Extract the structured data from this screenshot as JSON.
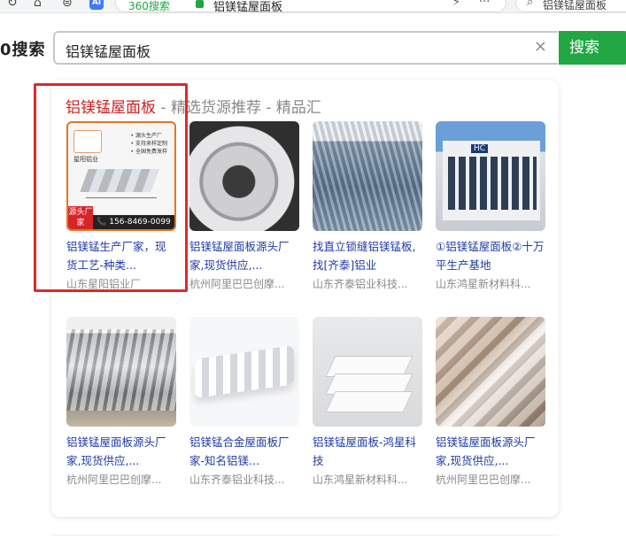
{
  "browser": {
    "tab_tag": "360搜索",
    "url_text": "铝镁锰屋面板",
    "side_search_text": "铝镁锰屋面板",
    "ai_badge": "AI"
  },
  "header": {
    "brand": "0搜索",
    "query": "铝镁锰屋面板",
    "clear_glyph": "×",
    "search_button": "搜索"
  },
  "result": {
    "title_highlight": "铝镁锰屋面板",
    "title_rest": " - 精选货源推荐 - 精品汇",
    "items": [
      {
        "title": "铝镁锰生产厂家，现货工艺-种类...",
        "source": "山东星阳铝业厂",
        "thumb_brand": "星阳铝业",
        "thumb_tag": "源头厂家",
        "thumb_phone": "156-8469-0099",
        "thumb_bullets": [
          "• 源头生产厂",
          "• 支持来样定制",
          "• 全国免费发样"
        ]
      },
      {
        "title": "铝镁锰屋面板源头厂家,现货供应,...",
        "source": "杭州阿里巴巴创摩..."
      },
      {
        "title": "找直立锁缝铝镁锰板,找[齐泰]铝业",
        "source": "山东齐泰铝业科技..."
      },
      {
        "title": "①铝镁锰屋面板②十万平生产基地",
        "source": "山东鸿星新材料科...",
        "thumb_sign": "HC"
      },
      {
        "title": "铝镁锰屋面板源头厂家,现货供应,...",
        "source": "杭州阿里巴巴创摩..."
      },
      {
        "title": "铝镁锰合金屋面板厂家-知名铝镁...",
        "source": "山东齐泰铝业科技..."
      },
      {
        "title": "铝镁锰屋面板-鸿星科技",
        "source": "山东鸿星新材料科..."
      },
      {
        "title": "铝镁锰屋面板源头厂家,现货供应,...",
        "source": "杭州阿里巴巴创摩..."
      }
    ]
  },
  "colors": {
    "accent_green": "#21a744",
    "highlight_red": "#e0282a",
    "link_blue": "#1f3aa6"
  }
}
